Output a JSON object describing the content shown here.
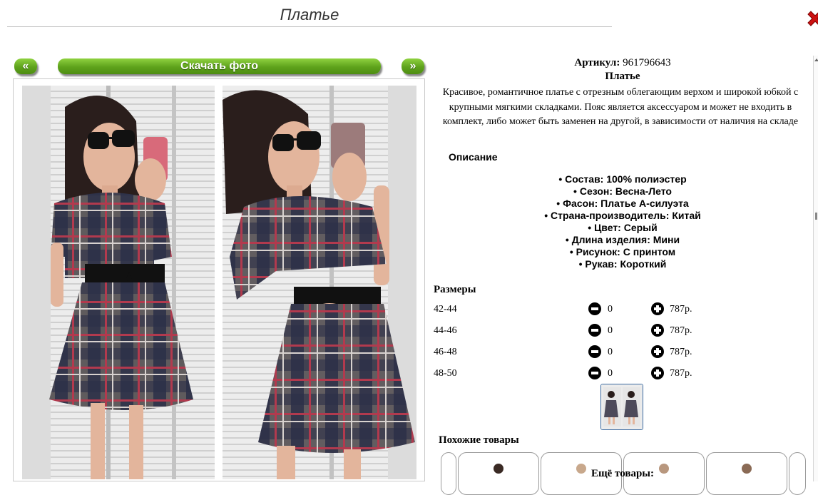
{
  "page": {
    "title": "Платье"
  },
  "gallery": {
    "prev_label": "«",
    "download_label": "Скачать фото",
    "next_label": "»"
  },
  "product": {
    "articul_label": "Артикул:",
    "articul_value": "961796643",
    "name": "Платье",
    "description": "Красивое, романтичное платье с отрезным облегающим верхом и широкой юбкой с крупными мягкими складками. Пояс является аксессуаром и может не входить в комплект, либо может быть заменен на другой, в зависимости от наличия на складе"
  },
  "opisanie": {
    "title": "Описание",
    "items": [
      "Состав: 100% полиэстер",
      "Сезон: Весна-Лето",
      "Фасон: Платье А-силуэта",
      "Страна-производитель: Китай",
      "Цвет: Серый",
      "Длина изделия: Мини",
      "Рисунок: С принтом",
      "Рукав: Короткий"
    ]
  },
  "sizes": {
    "title": "Размеры",
    "rows": [
      {
        "size": "42-44",
        "qty": "0",
        "price": "787р."
      },
      {
        "size": "44-46",
        "qty": "0",
        "price": "787р."
      },
      {
        "size": "46-48",
        "qty": "0",
        "price": "787р."
      },
      {
        "size": "48-50",
        "qty": "0",
        "price": "787р."
      }
    ]
  },
  "similar": {
    "title": "Похожие товары"
  },
  "more": {
    "title": "Ещё товары:"
  },
  "icons": {
    "close": "close-x-icon",
    "minus": "minus-circle-icon",
    "plus": "plus-circle-icon"
  },
  "colors": {
    "button_green": "#5ea21b",
    "close_red": "#cc1111",
    "thumb_border": "#3b6aa0"
  }
}
